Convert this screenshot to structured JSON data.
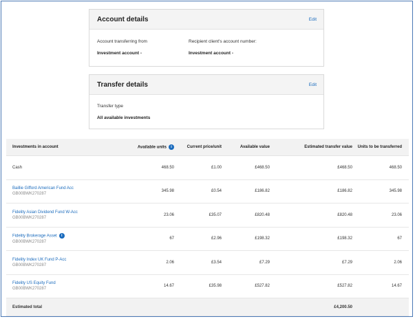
{
  "account_details": {
    "title": "Account details",
    "edit_label": "Edit",
    "from_label": "Account transferring from",
    "from_value": "Investment account -",
    "to_label": "Recipient client's account number:",
    "to_value": "Investment account -"
  },
  "transfer_details": {
    "title": "Transfer details",
    "edit_label": "Edit",
    "type_label": "Transfer type",
    "type_value": "All available investments"
  },
  "table": {
    "headers": [
      "Investments in account",
      "Available units",
      "Current price/unit",
      "Available value",
      "Estimated transfer value",
      "Units to be transferred"
    ],
    "info_glyph": "i",
    "rows": [
      {
        "name": "Cash",
        "code": "",
        "units": "468.50",
        "price": "£1.00",
        "value": "£468.50",
        "est": "£468.50",
        "transfer": "468.50",
        "info": false
      },
      {
        "name": "Baillie Gifford American Fund Acc",
        "code": "GB00BWK270287",
        "units": "345.98",
        "price": "£0.54",
        "value": "£186.82",
        "est": "£186.82",
        "transfer": "345.98",
        "info": false
      },
      {
        "name": "Fidelity Asian Dividend Fund W-Acc",
        "code": "GB00BWK270287",
        "units": "23.06",
        "price": "£35.07",
        "value": "£820.48",
        "est": "£820.48",
        "transfer": "23.06",
        "info": false
      },
      {
        "name": "Fidelity Brokerage Asset",
        "code": "GB00BWK270287",
        "units": "67",
        "price": "£2.96",
        "value": "£198.32",
        "est": "£198.32",
        "transfer": "67",
        "info": true
      },
      {
        "name": "Fidelity Index UK Fund P-Acc",
        "code": "GB00BWK270287",
        "units": "2.06",
        "price": "£3.54",
        "value": "£7.29",
        "est": "£7.29",
        "transfer": "2.06",
        "info": false
      },
      {
        "name": "Fidelity US Equity Fund",
        "code": "GB00BWK270287",
        "units": "14.67",
        "price": "£35.98",
        "value": "£527.82",
        "est": "£527.82",
        "transfer": "14.67",
        "info": false
      }
    ],
    "total_label": "Estimated total",
    "total_value": "£4,200.50"
  }
}
